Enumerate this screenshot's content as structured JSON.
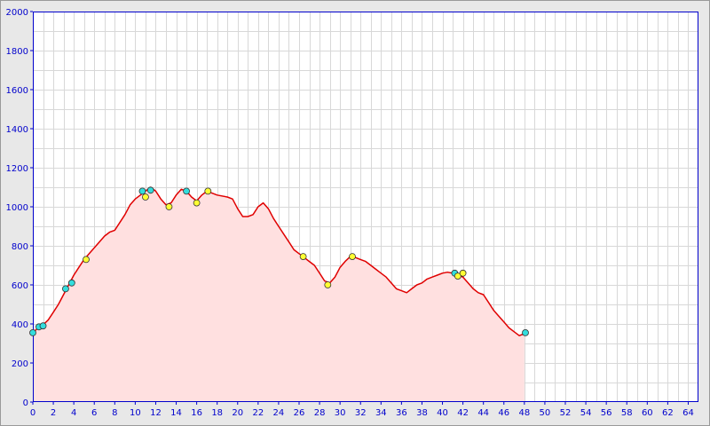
{
  "chart_data": {
    "type": "area",
    "title": "",
    "xlabel": "",
    "ylabel": "",
    "xlim": [
      0,
      65
    ],
    "ylim": [
      0,
      2000
    ],
    "x_ticks": [
      0,
      2,
      4,
      6,
      8,
      10,
      12,
      14,
      16,
      18,
      20,
      22,
      24,
      26,
      28,
      30,
      32,
      34,
      36,
      38,
      40,
      42,
      44,
      46,
      48,
      50,
      52,
      54,
      56,
      58,
      60,
      62,
      64
    ],
    "y_ticks": [
      0,
      200,
      400,
      600,
      800,
      1000,
      1200,
      1400,
      1600,
      1800,
      2000
    ],
    "grid": true,
    "legend": "none",
    "series": [
      {
        "color": "#e00000",
        "fill_color": "#ffe0e0",
        "points": [
          [
            0,
            355
          ],
          [
            0.5,
            380
          ],
          [
            1,
            395
          ],
          [
            1.5,
            420
          ],
          [
            2,
            460
          ],
          [
            2.5,
            500
          ],
          [
            3,
            550
          ],
          [
            3.5,
            600
          ],
          [
            4,
            650
          ],
          [
            4.5,
            690
          ],
          [
            5,
            730
          ],
          [
            5.5,
            760
          ],
          [
            6,
            790
          ],
          [
            6.5,
            820
          ],
          [
            7,
            850
          ],
          [
            7.5,
            870
          ],
          [
            8,
            880
          ],
          [
            8.5,
            920
          ],
          [
            9,
            960
          ],
          [
            9.5,
            1010
          ],
          [
            10,
            1040
          ],
          [
            10.5,
            1060
          ],
          [
            11,
            1080
          ],
          [
            11.5,
            1100
          ],
          [
            12,
            1080
          ],
          [
            12.5,
            1040
          ],
          [
            13,
            1010
          ],
          [
            13.5,
            1020
          ],
          [
            14,
            1060
          ],
          [
            14.5,
            1090
          ],
          [
            15,
            1080
          ],
          [
            15.5,
            1050
          ],
          [
            16,
            1030
          ],
          [
            16.5,
            1060
          ],
          [
            17,
            1080
          ],
          [
            17.5,
            1070
          ],
          [
            18,
            1060
          ],
          [
            19,
            1050
          ],
          [
            19.5,
            1040
          ],
          [
            20,
            990
          ],
          [
            20.5,
            950
          ],
          [
            21,
            950
          ],
          [
            21.5,
            960
          ],
          [
            22,
            1000
          ],
          [
            22.5,
            1020
          ],
          [
            23,
            990
          ],
          [
            23.5,
            940
          ],
          [
            24,
            900
          ],
          [
            24.5,
            860
          ],
          [
            25,
            820
          ],
          [
            25.5,
            780
          ],
          [
            26,
            760
          ],
          [
            26.5,
            740
          ],
          [
            27,
            720
          ],
          [
            27.5,
            700
          ],
          [
            28,
            660
          ],
          [
            28.5,
            620
          ],
          [
            29,
            610
          ],
          [
            29.5,
            640
          ],
          [
            30,
            690
          ],
          [
            30.5,
            720
          ],
          [
            31,
            745
          ],
          [
            31.5,
            740
          ],
          [
            32,
            730
          ],
          [
            32.5,
            720
          ],
          [
            33,
            700
          ],
          [
            33.5,
            680
          ],
          [
            34,
            660
          ],
          [
            34.5,
            640
          ],
          [
            35,
            610
          ],
          [
            35.5,
            580
          ],
          [
            36,
            570
          ],
          [
            36.5,
            560
          ],
          [
            37,
            580
          ],
          [
            37.5,
            600
          ],
          [
            38,
            610
          ],
          [
            38.5,
            630
          ],
          [
            39,
            640
          ],
          [
            39.5,
            650
          ],
          [
            40,
            660
          ],
          [
            40.5,
            665
          ],
          [
            41,
            660
          ],
          [
            41.5,
            650
          ],
          [
            42,
            640
          ],
          [
            42.5,
            610
          ],
          [
            43,
            580
          ],
          [
            43.5,
            560
          ],
          [
            44,
            550
          ],
          [
            44.5,
            510
          ],
          [
            45,
            470
          ],
          [
            45.5,
            440
          ],
          [
            46,
            410
          ],
          [
            46.5,
            380
          ],
          [
            47,
            360
          ],
          [
            47.5,
            340
          ],
          [
            48,
            350
          ]
        ]
      }
    ],
    "markers": [
      {
        "x": 0,
        "y": 355,
        "color": "#33dddd"
      },
      {
        "x": 0.6,
        "y": 385,
        "color": "#33dddd"
      },
      {
        "x": 1.0,
        "y": 390,
        "color": "#33dddd"
      },
      {
        "x": 3.2,
        "y": 580,
        "color": "#33dddd"
      },
      {
        "x": 3.8,
        "y": 610,
        "color": "#33dddd"
      },
      {
        "x": 5.2,
        "y": 730,
        "color": "#ffff33"
      },
      {
        "x": 10.7,
        "y": 1080,
        "color": "#33dddd"
      },
      {
        "x": 11.0,
        "y": 1050,
        "color": "#ffff33"
      },
      {
        "x": 11.5,
        "y": 1085,
        "color": "#33dddd"
      },
      {
        "x": 13.3,
        "y": 1000,
        "color": "#ffff33"
      },
      {
        "x": 15.0,
        "y": 1080,
        "color": "#33dddd"
      },
      {
        "x": 16.0,
        "y": 1020,
        "color": "#ffff33"
      },
      {
        "x": 17.1,
        "y": 1080,
        "color": "#ffff33"
      },
      {
        "x": 26.4,
        "y": 745,
        "color": "#ffff33"
      },
      {
        "x": 28.8,
        "y": 600,
        "color": "#ffff33"
      },
      {
        "x": 31.2,
        "y": 745,
        "color": "#ffff33"
      },
      {
        "x": 41.2,
        "y": 660,
        "color": "#33dddd"
      },
      {
        "x": 41.5,
        "y": 645,
        "color": "#ffff33"
      },
      {
        "x": 42.0,
        "y": 660,
        "color": "#ffff33"
      },
      {
        "x": 48.1,
        "y": 355,
        "color": "#33dddd"
      }
    ],
    "colors": {
      "plot_background": "#ffffff",
      "page_background": "#e8e8e8",
      "grid": "#d8d8d8",
      "axis": "#0000cc",
      "tick_label": "#0000cc"
    }
  }
}
